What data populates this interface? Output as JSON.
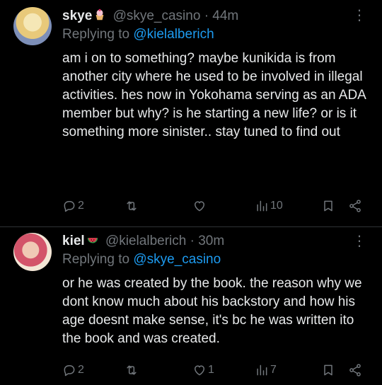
{
  "tweets": [
    {
      "name": "skye",
      "handle": "@skye_casino",
      "separator": "·",
      "time": "44m",
      "replying_prefix": "Replying to ",
      "replying_to": "@kielalberich",
      "body": "am i on to something? maybe kunikida is from another city where he used to be involved in illegal activities. hes now in Yokohama serving as an ADA member but why? is he starting a new life? or is it something more sinister.. stay tuned to find out",
      "stats": {
        "replies": "2",
        "retweets": "",
        "likes": "",
        "views": "10"
      },
      "icons": {
        "name_emoji": "cupcake-icon",
        "more": "more-icon"
      }
    },
    {
      "name": "kiel",
      "handle": "@kielalberich",
      "separator": "·",
      "time": "30m",
      "replying_prefix": "Replying to ",
      "replying_to": "@skye_casino",
      "body": "or he was created by the book. the reason why we dont know much about his backstory and how his age doesnt make sense, it's bc he was written ito the book and was created.",
      "stats": {
        "replies": "2",
        "retweets": "",
        "likes": "1",
        "views": "7"
      },
      "icons": {
        "name_emoji": "watermelon-icon",
        "more": "more-icon"
      }
    }
  ],
  "more_glyph": "⋮",
  "colors": {
    "background": "#000000",
    "text": "#e7e9ea",
    "muted": "#71767b",
    "link": "#1d9bf0"
  }
}
